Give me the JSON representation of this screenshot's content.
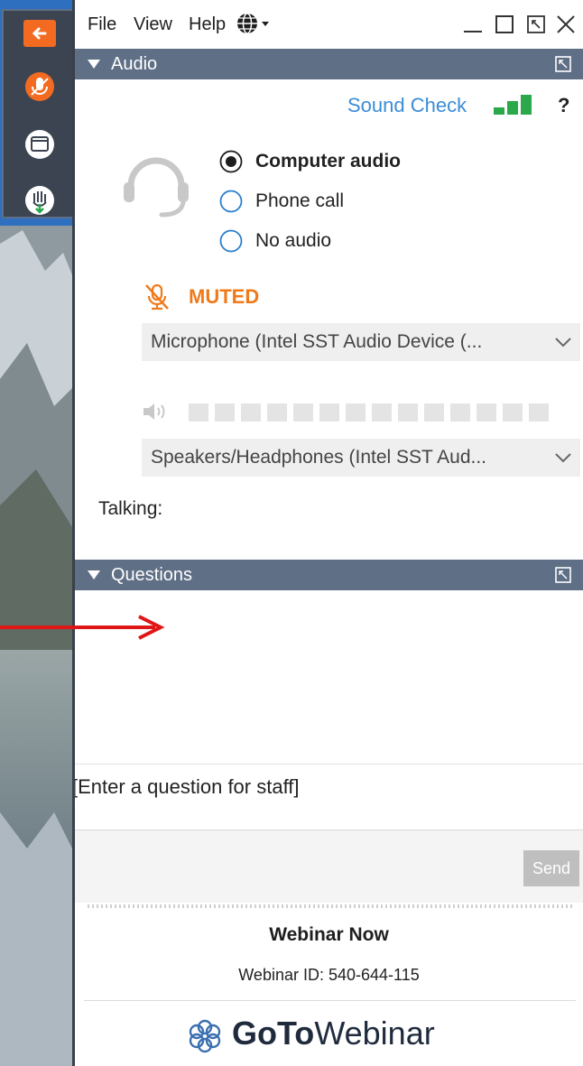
{
  "menubar": {
    "file": "File",
    "view": "View",
    "help": "Help",
    "language_icon": "globe-icon",
    "window_controls": [
      "minimize-icon",
      "maximize-icon",
      "popout-icon",
      "close-icon"
    ]
  },
  "side_toolbar": {
    "icons": [
      "collapse-arrow-icon",
      "microphone-icon",
      "screen-icon",
      "raise-hand-icon"
    ],
    "colors": {
      "accent": "#f26b21",
      "background": "#3c4452"
    }
  },
  "audio": {
    "header": "Audio",
    "sound_check": "Sound Check",
    "help": "?",
    "options": [
      {
        "label": "Computer audio",
        "selected": true
      },
      {
        "label": "Phone call",
        "selected": false
      },
      {
        "label": "No audio",
        "selected": false
      }
    ],
    "muted_label": "MUTED",
    "microphone_device": "Microphone (Intel SST Audio Device (...",
    "speaker_device": "Speakers/Headphones (Intel SST Aud...",
    "talking_label": "Talking:",
    "accent_color": "#f07a1a",
    "link_color": "#3a8dd6"
  },
  "questions": {
    "header": "Questions",
    "input_placeholder": "[Enter a question for staff]",
    "send_label": "Send"
  },
  "footer": {
    "title": "Webinar Now",
    "webinar_id": "Webinar ID: 540-644-115",
    "brand_part1": "GoTo",
    "brand_part2": "Webinar"
  }
}
